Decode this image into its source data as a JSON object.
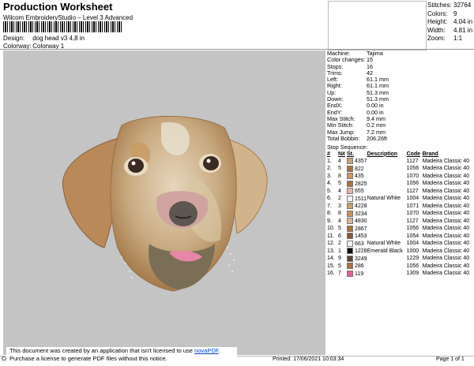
{
  "header": {
    "title": "Production Worksheet",
    "subtitle": "Wilcom EmbroideryStudio – Level 3 Advanced",
    "design_label": "Design:",
    "design_value": "dog head v3 4,8 in",
    "colorway_label": "Colorway:",
    "colorway_value": "Colorway 1"
  },
  "stats": [
    {
      "k": "Stitches:",
      "v": "32764"
    },
    {
      "k": "Colors:",
      "v": "9"
    },
    {
      "k": "Height:",
      "v": "4.04 in"
    },
    {
      "k": "Width:",
      "v": "4.81 in"
    },
    {
      "k": "Zoom:",
      "v": "1:1"
    }
  ],
  "machine_info": [
    {
      "k": "Machine:",
      "v": "Tajima"
    },
    {
      "k": "Color changes:",
      "v": "15"
    },
    {
      "k": "Stops:",
      "v": "16"
    },
    {
      "k": "Trims:",
      "v": "42"
    },
    {
      "k": "Left:",
      "v": "61.1 mm"
    },
    {
      "k": "Right:",
      "v": "61.1 mm"
    },
    {
      "k": "Up:",
      "v": "51.3 mm"
    },
    {
      "k": "Down:",
      "v": "51.3 mm"
    },
    {
      "k": "EndX:",
      "v": "0.00 in"
    },
    {
      "k": "EndY:",
      "v": "0.00 in"
    },
    {
      "k": "Max Stitch:",
      "v": "9.4 mm"
    },
    {
      "k": "Min Stitch:",
      "v": "0.2 mm"
    },
    {
      "k": "Max Jump:",
      "v": "7.2 mm"
    },
    {
      "k": "Total Bobbin:",
      "v": "206.26ft"
    }
  ],
  "stop_sequence": {
    "title": "Stop Sequence:",
    "headers": [
      "#",
      "N#",
      "St.",
      "Description",
      "Code",
      "Brand"
    ],
    "rows": [
      {
        "num": "1.",
        "n": "4",
        "color": "#c9a27a",
        "st": "4357",
        "desc": "",
        "code": "1127",
        "brand": "Madeira Classic 40"
      },
      {
        "num": "2.",
        "n": "5",
        "color": "#a9713d",
        "st": "822",
        "desc": "",
        "code": "1056",
        "brand": "Madeira Classic 40"
      },
      {
        "num": "3.",
        "n": "8",
        "color": "#c99a60",
        "st": "435",
        "desc": "",
        "code": "1070",
        "brand": "Madeira Classic 40"
      },
      {
        "num": "4.",
        "n": "5",
        "color": "#a9713d",
        "st": "2825",
        "desc": "",
        "code": "1056",
        "brand": "Madeira Classic 40"
      },
      {
        "num": "5.",
        "n": "4",
        "color": "#e2b7a4",
        "st": "655",
        "desc": "",
        "code": "1127",
        "brand": "Madeira Classic 40"
      },
      {
        "num": "6.",
        "n": "2",
        "color": "#f2f2f2",
        "st": "1511",
        "desc": "Natural White",
        "code": "1004",
        "brand": "Madeira Classic 40"
      },
      {
        "num": "7.",
        "n": "3",
        "color": "#c8a06c",
        "st": "4228",
        "desc": "",
        "code": "1071",
        "brand": "Madeira Classic 40"
      },
      {
        "num": "8.",
        "n": "8",
        "color": "#c49058",
        "st": "3234",
        "desc": "",
        "code": "1070",
        "brand": "Madeira Classic 40"
      },
      {
        "num": "9.",
        "n": "4",
        "color": "#dfb79a",
        "st": "4830",
        "desc": "",
        "code": "1127",
        "brand": "Madeira Classic 40"
      },
      {
        "num": "10.",
        "n": "5",
        "color": "#a9713d",
        "st": "2867",
        "desc": "",
        "code": "1056",
        "brand": "Madeira Classic 40"
      },
      {
        "num": "11.",
        "n": "6",
        "color": "#8a5a34",
        "st": "1453",
        "desc": "",
        "code": "1054",
        "brand": "Madeira Classic 40"
      },
      {
        "num": "12.",
        "n": "2",
        "color": "#f2f2f2",
        "st": "663",
        "desc": "Natural White",
        "code": "1004",
        "brand": "Madeira Classic 40"
      },
      {
        "num": "13.",
        "n": "1",
        "color": "#111111",
        "st": "1228",
        "desc": "Emerald Black",
        "code": "1000",
        "brand": "Madeira Classic 40"
      },
      {
        "num": "14.",
        "n": "9",
        "color": "#5b4536",
        "st": "3249",
        "desc": "",
        "code": "1229",
        "brand": "Madeira Classic 40"
      },
      {
        "num": "15.",
        "n": "5",
        "color": "#a9713d",
        "st": "286",
        "desc": "",
        "code": "1056",
        "brand": "Madeira Classic 40"
      },
      {
        "num": "16.",
        "n": "7",
        "color": "#e45f9a",
        "st": "119",
        "desc": "",
        "code": "1309",
        "brand": "Madeira Classic 40"
      }
    ]
  },
  "notice": {
    "line1_prefix": "This document was created by an application that isn't licensed to use ",
    "link": "novaPDF",
    "line1_suffix": ".",
    "line2": "Purchase a license to generate PDF files without this notice."
  },
  "footer": {
    "left": "Cr",
    "printed": "Printed: 17/06/2021 10:03:34",
    "page": "Page 1 of 1"
  }
}
